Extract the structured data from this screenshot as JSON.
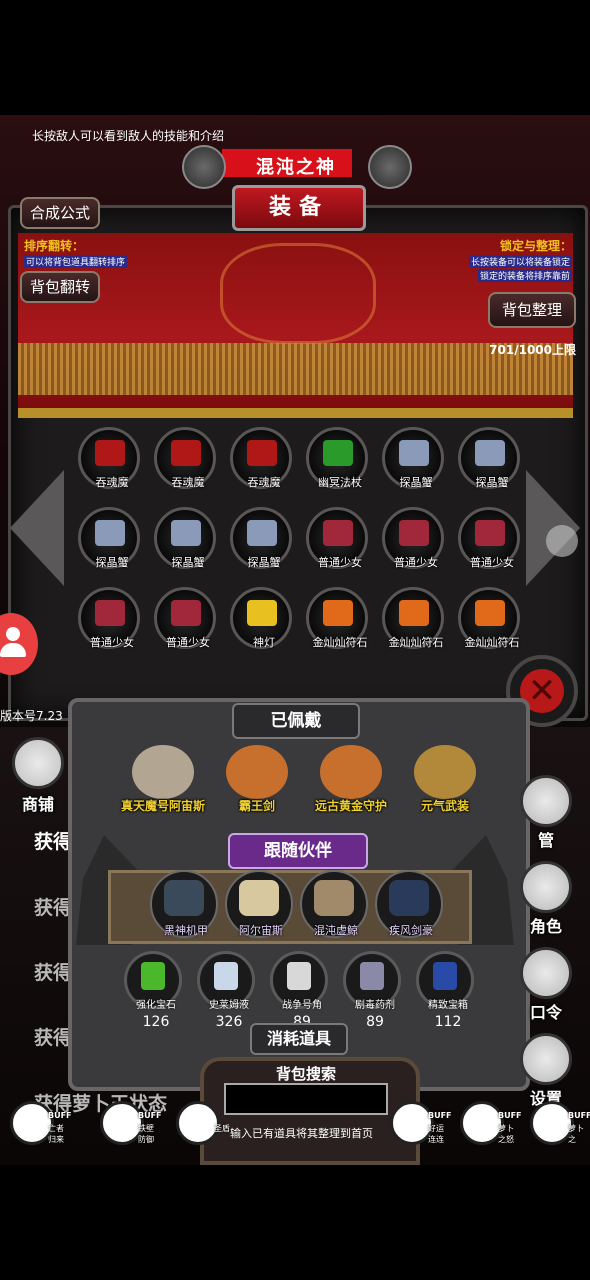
{
  "hint": "长按敌人可以看到敌人的技能和介绍",
  "boss_name": "混沌之神",
  "title": "装备",
  "buttons": {
    "compose": "合成公式",
    "flip": "背包翻转",
    "organize": "背包整理"
  },
  "sort_flip": {
    "title": "排序翻转：",
    "desc": "可以将背包道具翻转排序"
  },
  "lock_org": {
    "title": "锁定与整理：",
    "desc1": "长按装备可以将装备锁定",
    "desc2": "锁定的装备将排序靠前"
  },
  "capacity": "701/1000上限",
  "inventory": [
    {
      "name": "吞魂魔",
      "color": "#b01818"
    },
    {
      "name": "吞魂魔",
      "color": "#b01818"
    },
    {
      "name": "吞魂魔",
      "color": "#b01818"
    },
    {
      "name": "幽冥法杖",
      "color": "#2a9a2a"
    },
    {
      "name": "探晶蟹",
      "color": "#8a9ab8"
    },
    {
      "name": "探晶蟹",
      "color": "#8a9ab8"
    },
    {
      "name": "探晶蟹",
      "color": "#8a9ab8"
    },
    {
      "name": "探晶蟹",
      "color": "#8a9ab8"
    },
    {
      "name": "探晶蟹",
      "color": "#8a9ab8"
    },
    {
      "name": "普通少女",
      "color": "#a0283a"
    },
    {
      "name": "普通少女",
      "color": "#a0283a"
    },
    {
      "name": "普通少女",
      "color": "#a0283a"
    },
    {
      "name": "普通少女",
      "color": "#a0283a"
    },
    {
      "name": "普通少女",
      "color": "#a0283a"
    },
    {
      "name": "神灯",
      "color": "#e8c020"
    },
    {
      "name": "金灿灿符石",
      "color": "#e06a1a"
    },
    {
      "name": "金灿灿符石",
      "color": "#e06a1a"
    },
    {
      "name": "金灿灿符石",
      "color": "#e06a1a"
    }
  ],
  "version": "版本号7.23",
  "equipped_title": "已佩戴",
  "equipped": [
    {
      "name": "真天魔号阿宙斯",
      "color": "#c8b8a0"
    },
    {
      "name": "霸王剑",
      "color": "#e07a2a"
    },
    {
      "name": "远古黄金守护",
      "color": "#e07a2a"
    },
    {
      "name": "元气武装",
      "color": "#c8983a"
    }
  ],
  "partner_title": "跟随伙伴",
  "partners": [
    {
      "name": "黑神机甲",
      "color": "#3a4a5a"
    },
    {
      "name": "阿尔宙斯",
      "color": "#d8c8a0"
    },
    {
      "name": "混沌虚鲸",
      "color": "#a08a6a"
    },
    {
      "name": "疾风剑豪",
      "color": "#2a3a5a"
    }
  ],
  "consumables_title": "消耗道具",
  "consumables": [
    {
      "name": "强化宝石",
      "count": "126",
      "color": "#4ab82a"
    },
    {
      "name": "史莱姆液",
      "count": "326",
      "color": "#c8d8e8"
    },
    {
      "name": "战争号角",
      "count": "89",
      "color": "#d8d8d8"
    },
    {
      "name": "剧毒药剂",
      "count": "89",
      "color": "#8a8aa8"
    },
    {
      "name": "精致宝箱",
      "count": "112",
      "color": "#2a4aa8"
    }
  ],
  "search": {
    "title": "背包搜索",
    "hint": "输入已有道具将其整理到首页"
  },
  "side_left": {
    "shop": "商铺"
  },
  "side_right": [
    {
      "label": "管"
    },
    {
      "label": "角色"
    },
    {
      "label": "口令"
    },
    {
      "label": "设置"
    }
  ],
  "left_list": [
    "获得",
    "获得萝",
    "获得",
    "获得",
    "获得萝卜王状态"
  ],
  "buffs": [
    {
      "tag": "BUFF",
      "name": "亡者归来"
    },
    {
      "tag": "BUFF",
      "name": "铁壁防御"
    },
    {
      "tag": "",
      "name": "圣盾"
    },
    {
      "tag": "BUFF",
      "name": "好运连连"
    },
    {
      "tag": "BUFF",
      "name": "萝卜之怒"
    },
    {
      "tag": "BUFF",
      "name": "萝卜之"
    }
  ]
}
